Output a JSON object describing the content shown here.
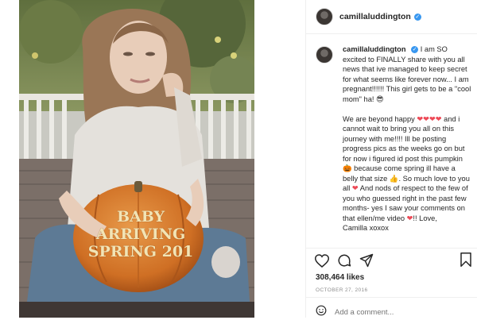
{
  "post": {
    "username": "camillaluddington",
    "verified_glyph": "✓",
    "pumpkin_text": [
      "BABY",
      "ARRIVING",
      "SPRING 201"
    ],
    "caption": {
      "username": "camillaluddington",
      "paragraph1": "I am SO excited to FINALLY share with you all news that ive managed to keep secret for what seems like forever now... I am pregnant!!!!!! This girl gets to be a \"cool mom\" ha! 😎",
      "paragraph2a": "We are beyond happy ",
      "hearts": "❤❤❤❤",
      "paragraph2b": " and i cannot wait to bring you all on this journey with me!!!! Ill be posting progress pics as the weeks go on but for now i figured id post this pumpkin 🎃 because come spring ill have a belly that size 👍. So much love to you all ",
      "heart_single": "❤",
      "paragraph2c": " And nods of respect to the few of you who guessed right in the past few months- yes I saw your comments on that ellen/me video ",
      "heart_single2": "❤",
      "paragraph2d": "!! Love,",
      "signoff": "Camilla xoxox"
    },
    "icons": {
      "like": "heart-outline-icon",
      "comment": "comment-icon",
      "share": "share-icon",
      "save": "bookmark-icon",
      "emoji": "smiley-icon"
    },
    "likes": "308,464 likes",
    "date": "OCTOBER 27, 2016",
    "comment_placeholder": "Add a comment..."
  },
  "colors": {
    "text": "#262626",
    "muted": "#8e8e8e",
    "verified": "#3897f0",
    "heart": "#ed4956",
    "pumpkin": "#d9792a"
  }
}
